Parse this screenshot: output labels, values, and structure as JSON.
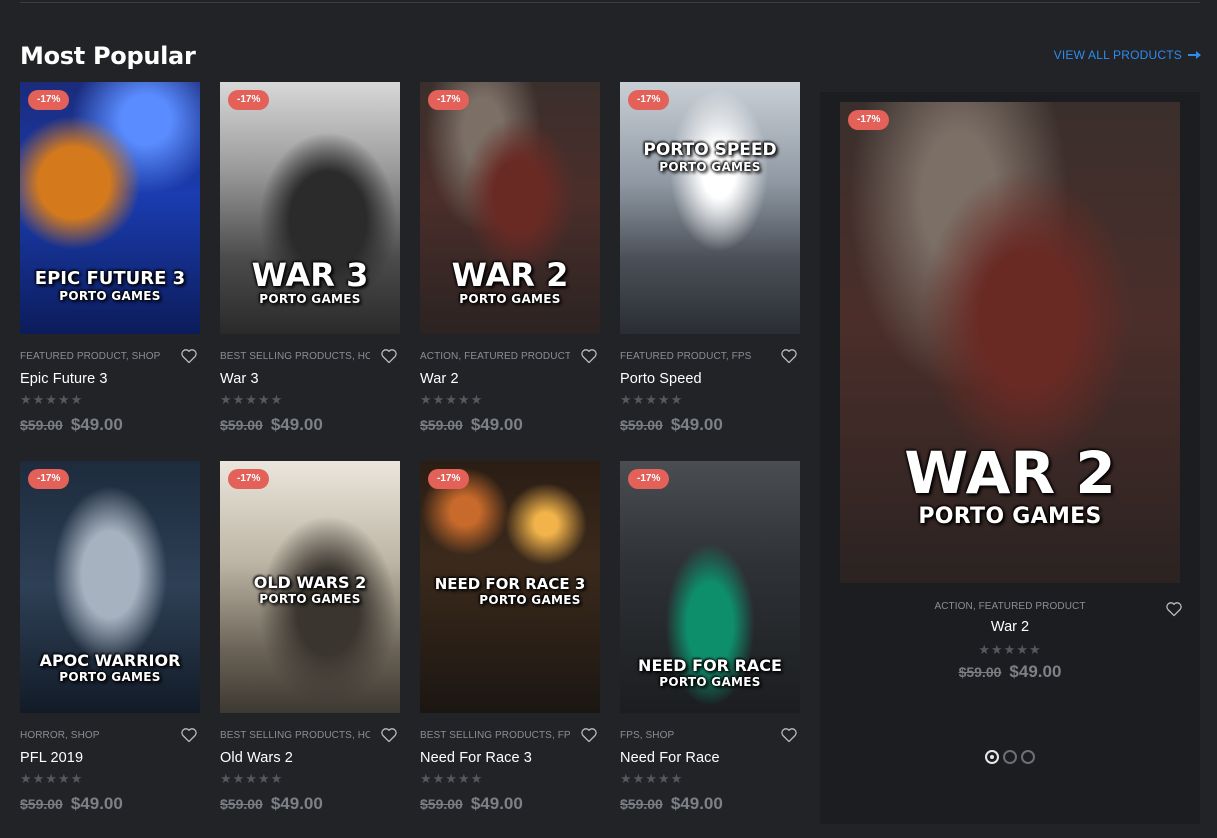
{
  "section": {
    "title": "Most Popular",
    "view_all_label": "VIEW ALL PRODUCTS"
  },
  "colors": {
    "background": "#212327",
    "panel": "#1b1d20",
    "accent_link": "#2e8bf0",
    "discount_badge": "#e36159"
  },
  "icons": {
    "wishlist": "heart-outline-icon",
    "rating": "star-icon",
    "view_all": "arrow-right-icon"
  },
  "products": [
    {
      "badge": "-17%",
      "art_title": "EPIC FUTURE 3",
      "art_sub": "PORTO GAMES",
      "categories": "FEATURED PRODUCT, SHOP",
      "name": "Epic Future 3",
      "rating": 0,
      "old_price": "$59.00",
      "price": "$49.00"
    },
    {
      "badge": "-17%",
      "art_title": "WAR 3",
      "art_sub": "PORTO GAMES",
      "categories": "BEST SELLING PRODUCTS, HO...",
      "name": "War 3",
      "rating": 0,
      "old_price": "$59.00",
      "price": "$49.00"
    },
    {
      "badge": "-17%",
      "art_title": "WAR 2",
      "art_sub": "PORTO GAMES",
      "categories": "ACTION, FEATURED PRODUCT",
      "name": "War 2",
      "rating": 0,
      "old_price": "$59.00",
      "price": "$49.00"
    },
    {
      "badge": "-17%",
      "art_title": "PORTO SPEED",
      "art_sub": "PORTO GAMES",
      "categories": "FEATURED PRODUCT, FPS",
      "name": "Porto Speed",
      "rating": 0,
      "old_price": "$59.00",
      "price": "$49.00"
    },
    {
      "badge": "-17%",
      "art_title": "APOC WARRIOR",
      "art_sub": "PORTO GAMES",
      "categories": "HORROR, SHOP",
      "name": "PFL 2019",
      "rating": 0,
      "old_price": "$59.00",
      "price": "$49.00"
    },
    {
      "badge": "-17%",
      "art_title": "OLD WARS 2",
      "art_sub": "PORTO GAMES",
      "categories": "BEST SELLING PRODUCTS, HO...",
      "name": "Old Wars 2",
      "rating": 0,
      "old_price": "$59.00",
      "price": "$49.00"
    },
    {
      "badge": "-17%",
      "art_title": "NEED FOR RACE 3",
      "art_sub": "PORTO GAMES",
      "categories": "BEST SELLING PRODUCTS, FPS",
      "name": "Need For Race 3",
      "rating": 0,
      "old_price": "$59.00",
      "price": "$49.00"
    },
    {
      "badge": "-17%",
      "art_title": "NEED FOR RACE",
      "art_sub": "PORTO GAMES",
      "categories": "FPS, SHOP",
      "name": "Need For Race",
      "rating": 0,
      "old_price": "$59.00",
      "price": "$49.00"
    }
  ],
  "featured": {
    "badge": "-17%",
    "art_title": "WAR 2",
    "art_sub": "PORTO GAMES",
    "categories": "ACTION, FEATURED PRODUCT",
    "name": "War 2",
    "rating": 0,
    "old_price": "$59.00",
    "price": "$49.00",
    "slides": 3,
    "active_slide": 1
  }
}
